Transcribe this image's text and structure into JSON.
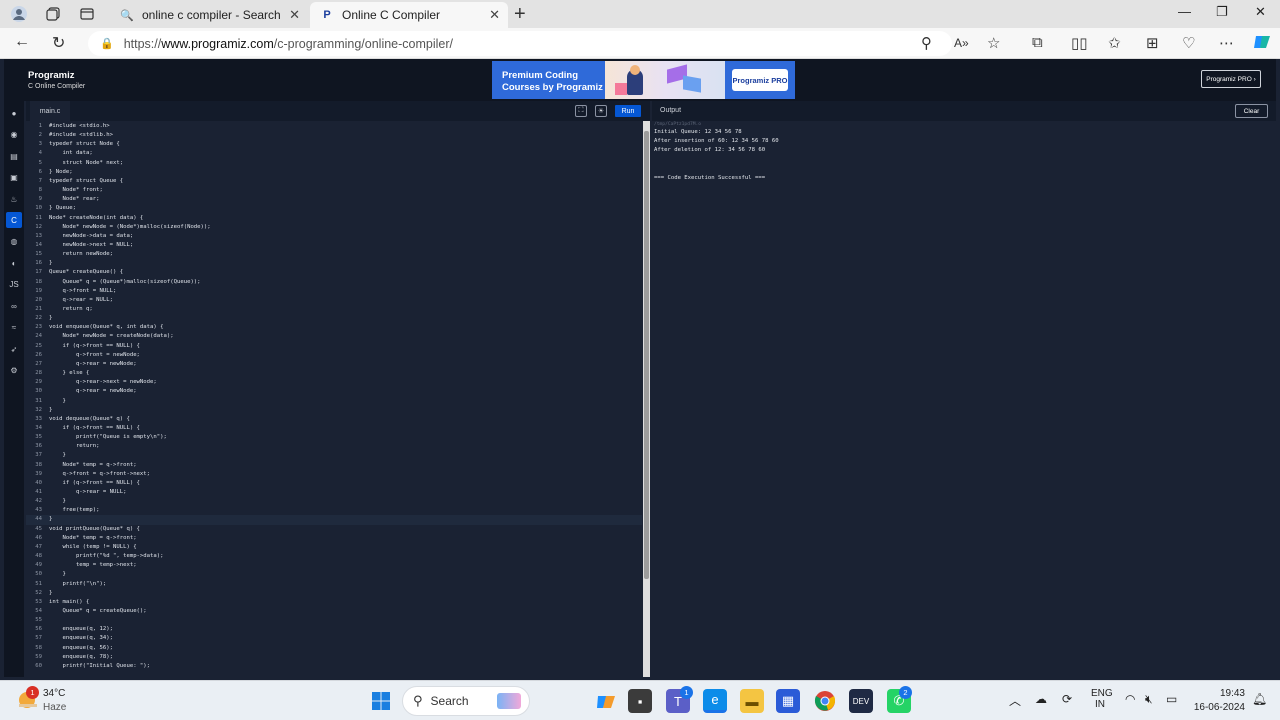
{
  "browser": {
    "tabs": [
      {
        "title": "online c compiler - Search",
        "icon": "search-icon",
        "active": false
      },
      {
        "title": "Online C Compiler",
        "icon": "programiz-favicon",
        "active": true
      }
    ],
    "url_prefix": "https://",
    "url_domain": "www.programiz.com",
    "url_path": "/c-programming/online-compiler/"
  },
  "header": {
    "logo": "Programiz",
    "subtitle": "C Online Compiler",
    "ad_line1": "Premium Coding",
    "ad_line2": "Courses by Programiz",
    "ad_badge": "Programiz PRO",
    "pro_button": "Programiz PRO ›"
  },
  "editor": {
    "file_tab": "main.c",
    "run_label": "Run",
    "highlighted_line": 44,
    "lines": [
      "#include <stdio.h>",
      "#include <stdlib.h>",
      "typedef struct Node {",
      "    int data;",
      "    struct Node* next;",
      "} Node;",
      "typedef struct Queue {",
      "    Node* front;",
      "    Node* rear;",
      "} Queue;",
      "Node* createNode(int data) {",
      "    Node* newNode = (Node*)malloc(sizeof(Node));",
      "    newNode->data = data;",
      "    newNode->next = NULL;",
      "    return newNode;",
      "}",
      "Queue* createQueue() {",
      "    Queue* q = (Queue*)malloc(sizeof(Queue));",
      "    q->front = NULL;",
      "    q->rear = NULL;",
      "    return q;",
      "}",
      "void enqueue(Queue* q, int data) {",
      "    Node* newNode = createNode(data);",
      "    if (q->front == NULL) {",
      "        q->front = newNode;",
      "        q->rear = newNode;",
      "    } else {",
      "        q->rear->next = newNode;",
      "        q->rear = newNode;",
      "    }",
      "}",
      "void dequeue(Queue* q) {",
      "    if (q->front == NULL) {",
      "        printf(\"Queue is empty\\n\");",
      "        return;",
      "    }",
      "    Node* temp = q->front;",
      "    q->front = q->front->next;",
      "    if (q->front == NULL) {",
      "        q->rear = NULL;",
      "    }",
      "    free(temp);",
      "}",
      "void printQueue(Queue* q) {",
      "    Node* temp = q->front;",
      "    while (temp != NULL) {",
      "        printf(\"%d \", temp->data);",
      "        temp = temp->next;",
      "    }",
      "    printf(\"\\n\");",
      "}",
      "int main() {",
      "    Queue* q = createQueue();",
      "",
      "    enqueue(q, 12);",
      "    enqueue(q, 34);",
      "    enqueue(q, 56);",
      "    enqueue(q, 78);",
      "    printf(\"Initial Queue: \");"
    ]
  },
  "output": {
    "label": "Output",
    "clear_label": "Clear",
    "path": "/tmp/CaPtz1pd7M.o",
    "lines": [
      "Initial Queue: 12 34 56 78",
      "After insertion of 60: 12 34 56 78 60",
      "After deletion of 12: 34 56 78 60",
      "",
      "",
      "=== Code Execution Successful ==="
    ]
  },
  "taskbar": {
    "temperature": "34°C",
    "weather": "Haze",
    "weather_badge": "1",
    "search_placeholder": "Search",
    "teams_badge": "1",
    "whatsapp_badge": "2",
    "lang_line1": "ENG",
    "lang_line2": "IN",
    "time": "19:43",
    "date": "16-06-2024"
  },
  "colors": {
    "accent": "#0557d4",
    "page_bg": "#1a2233",
    "header_bg": "#0f1521"
  }
}
